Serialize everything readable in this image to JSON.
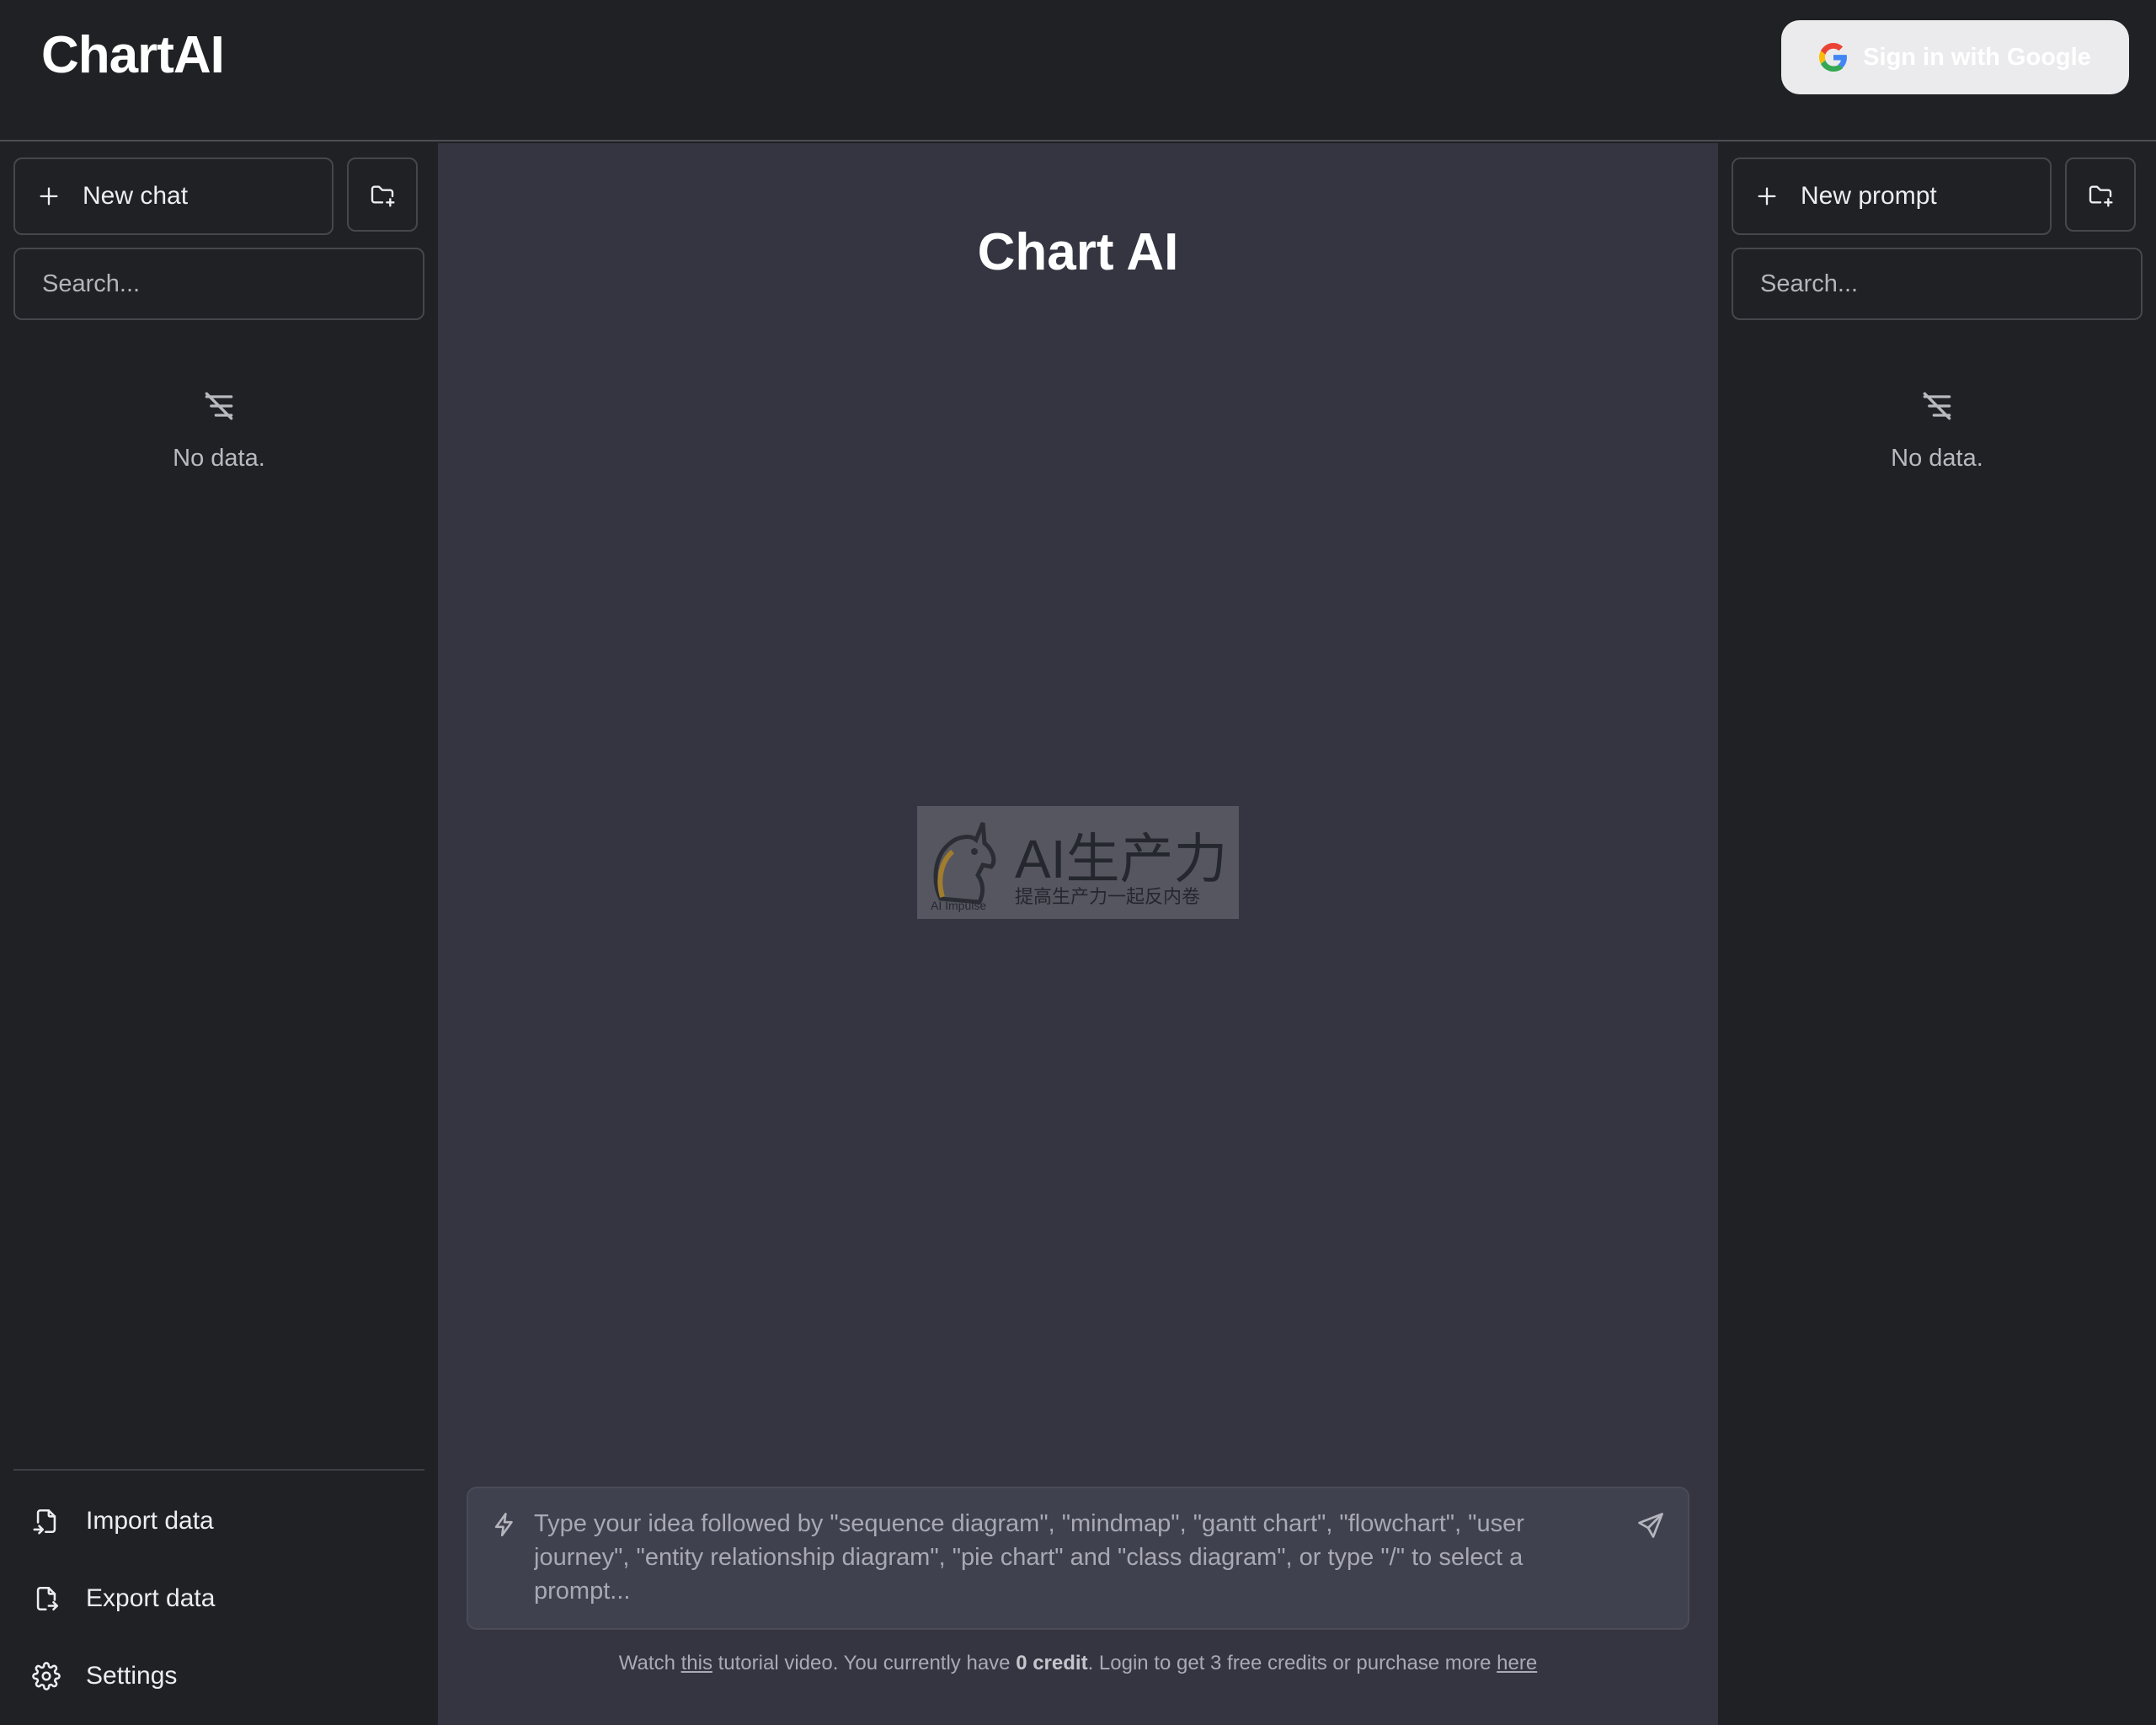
{
  "header": {
    "brand": "ChartAI",
    "signin_label": "Sign in with Google"
  },
  "left_sidebar": {
    "new_chat_label": "New chat",
    "search_placeholder": "Search...",
    "empty_label": "No data.",
    "menu": [
      {
        "label": "Import data",
        "icon": "file-import-icon"
      },
      {
        "label": "Export data",
        "icon": "file-export-icon"
      },
      {
        "label": "Settings",
        "icon": "gear-icon"
      }
    ]
  },
  "right_sidebar": {
    "new_prompt_label": "New prompt",
    "search_placeholder": "Search...",
    "empty_label": "No data."
  },
  "main": {
    "title": "Chart AI",
    "watermark": {
      "big": "AI生产力",
      "small": "提高生产力一起反内卷",
      "tiny": "AI Impulse"
    },
    "composer_placeholder": "Type your idea followed by \"sequence diagram\", \"mindmap\", \"gantt chart\", \"flowchart\", \"user journey\", \"entity relationship diagram\", \"pie chart\" and \"class diagram\", or type \"/\" to select a prompt...",
    "footer": {
      "part1": "Watch ",
      "link_this": "this",
      "part2": " tutorial video. You currently have ",
      "credit": "0 credit",
      "part3": ". Login to get 3 free credits or purchase more ",
      "link_here": "here"
    }
  },
  "colors": {
    "app_bg": "#202124",
    "main_bg": "#343541",
    "composer_bg": "#40414f",
    "signin_bg": "#ebebed"
  }
}
